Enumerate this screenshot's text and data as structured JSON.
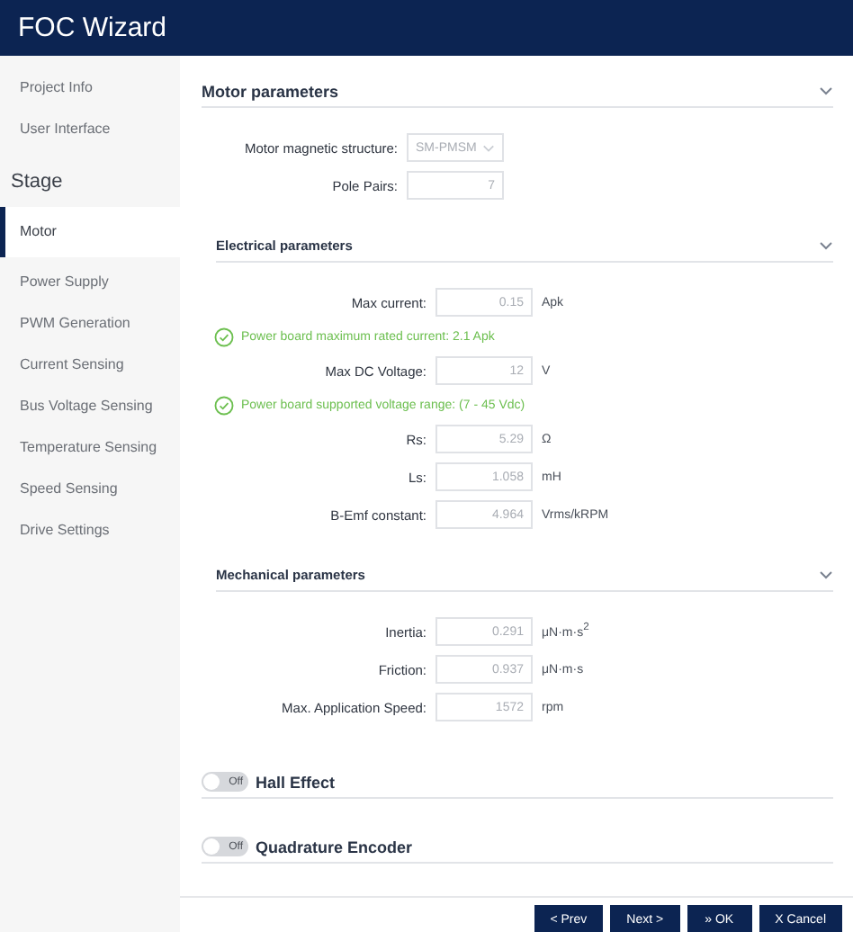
{
  "window": {
    "title": "FOC Wizard"
  },
  "sidebar": {
    "top_items": [
      {
        "label": "Project Info",
        "selected": false
      },
      {
        "label": "User Interface",
        "selected": false
      }
    ],
    "section_title": "Stage",
    "stage_items": [
      {
        "label": "Motor",
        "selected": true
      },
      {
        "label": "Power Supply",
        "selected": false
      },
      {
        "label": "PWM Generation",
        "selected": false
      },
      {
        "label": "Current Sensing",
        "selected": false
      },
      {
        "label": "Bus Voltage Sensing",
        "selected": false
      },
      {
        "label": "Temperature Sensing",
        "selected": false
      },
      {
        "label": "Speed Sensing",
        "selected": false
      },
      {
        "label": "Drive Settings",
        "selected": false
      }
    ]
  },
  "sections": [
    {
      "title": "Motor parameters",
      "kind": "main",
      "expanded": true,
      "rows": [
        {
          "kind": "select",
          "label": "Motor magnetic structure:",
          "value": "SM-PMSM"
        },
        {
          "kind": "field",
          "label": "Pole Pairs:",
          "value": "7"
        }
      ]
    },
    {
      "title": "Electrical parameters",
      "kind": "sub",
      "expanded": true,
      "rows": [
        {
          "kind": "field",
          "label": "Max current:",
          "value": "0.15",
          "unit": "Apk"
        },
        {
          "kind": "message",
          "text": "Power board maximum rated current: 2.1 Apk"
        },
        {
          "kind": "field",
          "label": "Max DC Voltage:",
          "value": "12",
          "unit": "V"
        },
        {
          "kind": "message",
          "text": "Power board supported voltage range: (7 - 45 Vdc)"
        },
        {
          "kind": "field",
          "label": "Rs:",
          "value": "5.29",
          "unit": "Ω"
        },
        {
          "kind": "field",
          "label": "Ls:",
          "value": "1.058",
          "unit": "mH"
        },
        {
          "kind": "field",
          "label": "B-Emf constant:",
          "value": "4.964",
          "unit": "Vrms/kRPM"
        }
      ]
    },
    {
      "title": "Mechanical parameters",
      "kind": "sub",
      "expanded": true,
      "rows": [
        {
          "kind": "field",
          "label": "Inertia:",
          "value": "0.291",
          "unit": "μN·m·s$^{2}$"
        },
        {
          "kind": "field",
          "label": "Friction:",
          "value": "0.937",
          "unit": "μN·m·s"
        },
        {
          "kind": "field",
          "label": "Max. Application Speed:",
          "value": "1572",
          "unit": "rpm"
        }
      ]
    }
  ],
  "toggles": [
    {
      "label": "Hall Effect",
      "on": false,
      "state_text": "Off"
    },
    {
      "label": "Quadrature Encoder",
      "on": false,
      "state_text": "Off"
    }
  ],
  "buttons": [
    "< Prev",
    "Next >",
    "» OK",
    "X Cancel"
  ]
}
